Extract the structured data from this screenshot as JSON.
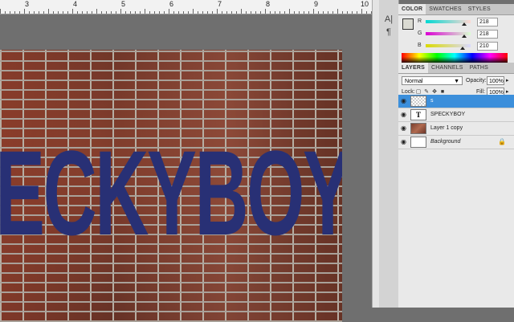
{
  "ruler": {
    "numbers": [
      "3",
      "4",
      "5",
      "6",
      "7",
      "8",
      "9",
      "10"
    ]
  },
  "canvas": {
    "overlay_text": "ECKYBOY"
  },
  "color_panel": {
    "tabs": [
      "COLOR",
      "SWATCHES",
      "STYLES"
    ],
    "channels": [
      {
        "label": "R",
        "value": "218",
        "gradient": [
          "#00d8d2",
          "#ffd8d2"
        ]
      },
      {
        "label": "G",
        "value": "218",
        "gradient": [
          "#da00d2",
          "#daffd2"
        ]
      },
      {
        "label": "B",
        "value": "210",
        "gradient": [
          "#dada00",
          "#dadaff"
        ]
      }
    ],
    "foreground_color": "#dadad2"
  },
  "layers_panel": {
    "tabs": [
      "LAYERS",
      "CHANNELS",
      "PATHS"
    ],
    "blend_mode": "Normal",
    "opacity_label": "Opacity:",
    "opacity_value": "100%",
    "lock_label": "Lock:",
    "fill_label": "Fill:",
    "fill_value": "100%",
    "layers": [
      {
        "name": "s",
        "thumb": "transparent",
        "selected": true,
        "italic": false,
        "locked": false
      },
      {
        "name": "SPECKYBOY",
        "thumb": "text",
        "selected": false,
        "italic": false,
        "locked": false
      },
      {
        "name": "Layer 1 copy",
        "thumb": "brick",
        "selected": false,
        "italic": false,
        "locked": false
      },
      {
        "name": "Background",
        "thumb": "white",
        "selected": false,
        "italic": true,
        "locked": true
      }
    ]
  }
}
